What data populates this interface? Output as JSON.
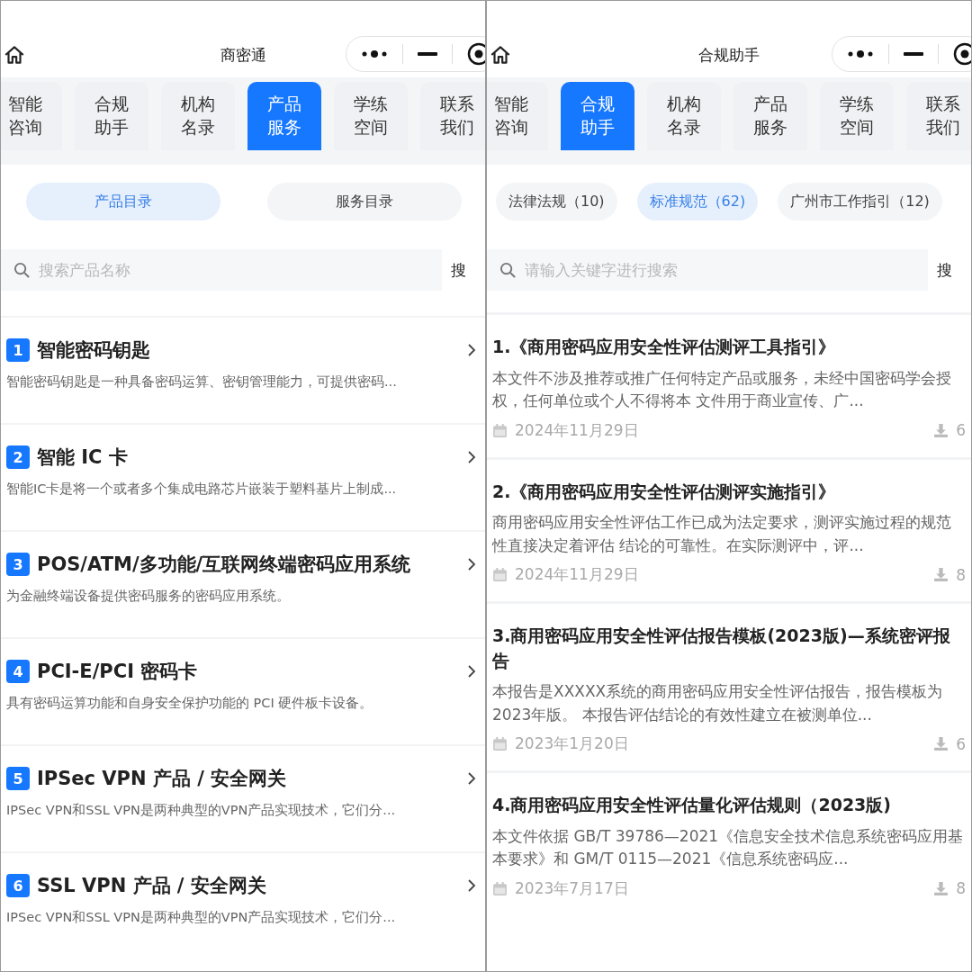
{
  "panels": [
    {
      "kind": "products",
      "title": "商密通",
      "tabs": [
        {
          "label": "智能咨询",
          "selected": false
        },
        {
          "label": "合规助手",
          "selected": false
        },
        {
          "label": "机构名录",
          "selected": false
        },
        {
          "label": "产品服务",
          "selected": true
        },
        {
          "label": "学练空间",
          "selected": false
        },
        {
          "label": "联系我们",
          "selected": false
        }
      ],
      "chips": [
        {
          "label": "产品目录",
          "selected": true
        },
        {
          "label": "服务目录",
          "selected": false
        }
      ],
      "search": {
        "placeholder": "搜索产品名称",
        "button": "搜"
      },
      "items": [
        {
          "number": "1",
          "title": "智能密码钥匙",
          "description": "智能密码钥匙是一种具备密码运算、密钥管理能力，可提供密码..."
        },
        {
          "number": "2",
          "title": "智能 IC 卡",
          "description": "智能IC卡是将一个或者多个集成电路芯片嵌装于塑料基片上制成..."
        },
        {
          "number": "3",
          "title": "POS/ATM/多功能/互联网终端密码应用系统",
          "description": "为金融终端设备提供密码服务的密码应用系统。"
        },
        {
          "number": "4",
          "title": "PCI-E/PCI 密码卡",
          "description": "具有密码运算功能和自身安全保护功能的 PCI 硬件板卡设备。"
        },
        {
          "number": "5",
          "title": "IPSec VPN 产品 / 安全网关",
          "description": "IPSec VPN和SSL VPN是两种典型的VPN产品实现技术，它们分..."
        },
        {
          "number": "6",
          "title": "SSL VPN 产品 / 安全网关",
          "description": "IPSec VPN和SSL VPN是两种典型的VPN产品实现技术，它们分..."
        }
      ]
    },
    {
      "kind": "documents",
      "title": "合规助手",
      "tabs": [
        {
          "label": "智能咨询",
          "selected": false
        },
        {
          "label": "合规助手",
          "selected": true
        },
        {
          "label": "机构名录",
          "selected": false
        },
        {
          "label": "产品服务",
          "selected": false
        },
        {
          "label": "学练空间",
          "selected": false
        },
        {
          "label": "联系我们",
          "selected": false
        }
      ],
      "chips": [
        {
          "label": "法律法规（10)",
          "selected": false
        },
        {
          "label": "标准规范（62)",
          "selected": true
        },
        {
          "label": "广州市工作指引（12)",
          "selected": false
        }
      ],
      "search": {
        "placeholder": "请输入关键字进行搜索",
        "button": "搜"
      },
      "items": [
        {
          "title": "1.《商用密码应用安全性评估测评工具指引》",
          "description": "本文件不涉及推荐或推广任何特定产品或服务，未经中国密码学会授权，任何单位或个人不得将本 文件用于商业宣传、广...",
          "date": "2024年11月29日",
          "downloads": "6"
        },
        {
          "title": "2.《商用密码应用安全性评估测评实施指引》",
          "description": "商用密码应用安全性评估工作已成为法定要求，测评实施过程的规范性直接决定着评估 结论的可靠性。在实际测评中，评...",
          "date": "2024年11月29日",
          "downloads": "8"
        },
        {
          "title": "3.商用密码应用安全性评估报告模板(2023版)—系统密评报告",
          "description": "本报告是XXXXX系统的商用密码应用安全性评估报告，报告模板为2023年版。 本报告评估结论的有效性建立在被测单位...",
          "date": "2023年1月20日",
          "downloads": "6"
        },
        {
          "title": "4.商用密码应用安全性评估量化评估规则（2023版)",
          "description": "本文件依据 GB/T 39786—2021《信息安全技术信息系统密码应用基本要求》和 GM/T 0115—2021《信息系统密码应...",
          "date": "2023年7月17日",
          "downloads": "8"
        }
      ]
    }
  ]
}
